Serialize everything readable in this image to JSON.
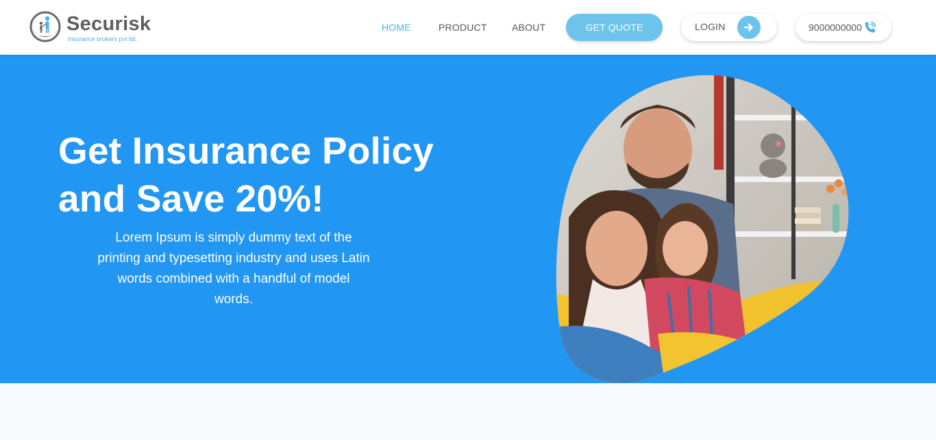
{
  "brand": {
    "name": "Securisk",
    "tagline": "Insurance brokers pvt ltd."
  },
  "nav": {
    "items": [
      "HOME",
      "PRODUCT",
      "ABOUT"
    ],
    "active": "HOME"
  },
  "actions": {
    "quote_label": "GET QUOTE",
    "login_label": "LOGIN",
    "phone_number": "9000000000"
  },
  "hero": {
    "title_line1": "Get Insurance Policy",
    "title_line2": "and Save 20%!",
    "description": "Lorem Ipsum is simply dummy text of the printing  and typesetting industry and uses Latin words combined with a handful of model words."
  },
  "colors": {
    "hero_background": "#2196f3",
    "accent": "#6cc3ec",
    "nav_active": "#4fb3e3",
    "text_gray": "#555555"
  },
  "icons": {
    "login": "arrow-right-icon",
    "phone": "phone-call-icon",
    "logo": "family-umbrella-logo-icon"
  }
}
